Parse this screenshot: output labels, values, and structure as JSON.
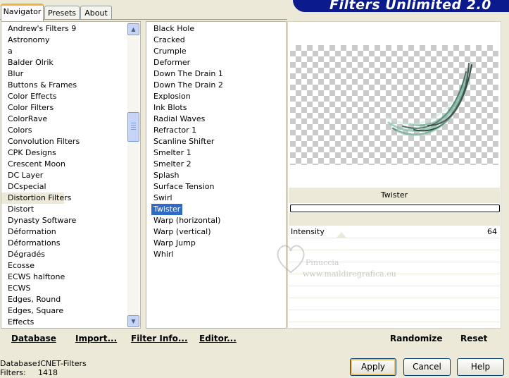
{
  "tabs": [
    "Navigator",
    "Presets",
    "About"
  ],
  "banner_title": "Filters Unlimited 2.0",
  "categories": [
    "Andrew's Filters 9",
    "Astronomy",
    "a",
    "Balder Olrik",
    "Blur",
    "Buttons & Frames",
    "Color Effects",
    "Color Filters",
    "ColorRave",
    "Colors",
    "Convolution Filters",
    "CPK Designs",
    "Crescent Moon",
    "DC Layer",
    "DCspecial",
    "Distortion Filters",
    "Distort",
    "Dynasty Software",
    "Déformation",
    "Déformations",
    "Dégradés",
    "Ecosse",
    "ECWS halftone",
    "ECWS",
    "Edges, Round",
    "Edges, Square",
    "Effects"
  ],
  "selected_category": "Distortion Filters",
  "filters": [
    "Black Hole",
    "Cracked",
    "Crumple",
    "Deformer",
    "Down The Drain 1",
    "Down The Drain 2",
    "Explosion",
    "Ink Blots",
    "Radial Waves",
    "Refractor 1",
    "Scanline Shifter",
    "Smelter 1",
    "Smelter 2",
    "Splash",
    "Surface Tension",
    "Swirl",
    "Twister",
    "Warp (horizontal)",
    "Warp (vertical)",
    "Warp Jump",
    "Whirl"
  ],
  "selected_filter": "Twister",
  "bottom_links": {
    "database": "Database",
    "import": "Import...",
    "filter_info": "Filter Info...",
    "editor": "Editor..."
  },
  "preview": {
    "filter_name": "Twister"
  },
  "parameter": {
    "label": "Intensity",
    "value": "64",
    "fraction": 0.25
  },
  "watermark": {
    "line1": "Pinuccia",
    "line2": "www.maildiregrafica.eu"
  },
  "right_links": {
    "randomize": "Randomize",
    "reset": "Reset"
  },
  "status": {
    "database_label": "Database:",
    "database_value": "ICNET-Filters",
    "filters_label": "Filters:",
    "filters_value": "1418"
  },
  "buttons": {
    "apply": "Apply",
    "cancel": "Cancel",
    "help": "Help"
  },
  "colors": {
    "selection": "#316ac5",
    "banner": "#0b1a8c"
  }
}
